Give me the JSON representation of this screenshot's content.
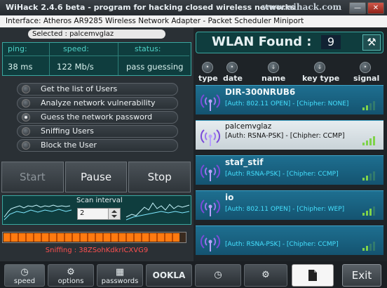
{
  "window": {
    "title": "WiHack 2.4.6 beta - program for hacking closed wireless networks",
    "url": "www.wihack.com",
    "interface_text": "Interface:  Atheros AR9285 Wireless Network Adapter - Packet Scheduler Miniport"
  },
  "left": {
    "selected_text": "Selected : palcemvglaz",
    "stats": {
      "ping_label": "ping:",
      "ping_value": "38 ms",
      "speed_label": "speed:",
      "speed_value": "122 Mb/s",
      "status_label": "status:",
      "status_value": "pass guessing"
    },
    "menu": [
      {
        "label": "Get the list of Users",
        "selected": false
      },
      {
        "label": "Analyze network vulnerability",
        "selected": false
      },
      {
        "label": "Guess the network password",
        "selected": true
      },
      {
        "label": "Sniffing Users",
        "selected": false
      },
      {
        "label": "Block the User",
        "selected": false
      }
    ],
    "buttons": {
      "start": "Start",
      "pause": "Pause",
      "stop": "Stop"
    },
    "scan": {
      "label": "Scan interval",
      "value": "2"
    },
    "progress": 0.97,
    "sniffing_text": "Sniffing : 38ZSohKdkrICXVG9"
  },
  "right": {
    "wlan_label": "WLAN Found :",
    "wlan_count": "9",
    "columns": {
      "type": "type",
      "date": "date",
      "name": "name",
      "key_type": "key type",
      "signal": "signal"
    },
    "networks": [
      {
        "name": "DIR-300NRUB6",
        "detail": "[Auth: 802.11 OPEN] - [Chipher: NONE]",
        "signal": 2,
        "selected": false
      },
      {
        "name": "palcemvglaz",
        "detail": "[Auth: RSNA-PSK] - [Chipher: CCMP]",
        "signal": 4,
        "selected": true
      },
      {
        "name": "staf_stif",
        "detail": "[Auth: RSNA-PSK] - [Chipher: CCMP]",
        "signal": 2,
        "selected": false
      },
      {
        "name": "io",
        "detail": "[Auth: 802.11 OPEN] - [Chipher: WEP]",
        "signal": 3,
        "selected": false
      },
      {
        "name": "",
        "detail": "[Auth: RSNA-PSK] - [Chipher: CCMP]",
        "signal": 2,
        "selected": false
      }
    ]
  },
  "toolbar": {
    "speed": "speed",
    "options": "options",
    "passwords": "passwords",
    "ookla": "OOKLA",
    "exit": "Exit"
  },
  "icons": {
    "speed": "gauge-icon",
    "options": "gear-icon",
    "passwords": "key-icon",
    "ookla": "ookla-logo",
    "history": "clock-icon",
    "settings": "gear-icon",
    "document": "document-icon"
  },
  "colors": {
    "accent_teal": "#0f3d3e",
    "net_blue": "#1e6f90",
    "progress_orange": "#ff7a10",
    "sniff_red": "#ff5050"
  }
}
